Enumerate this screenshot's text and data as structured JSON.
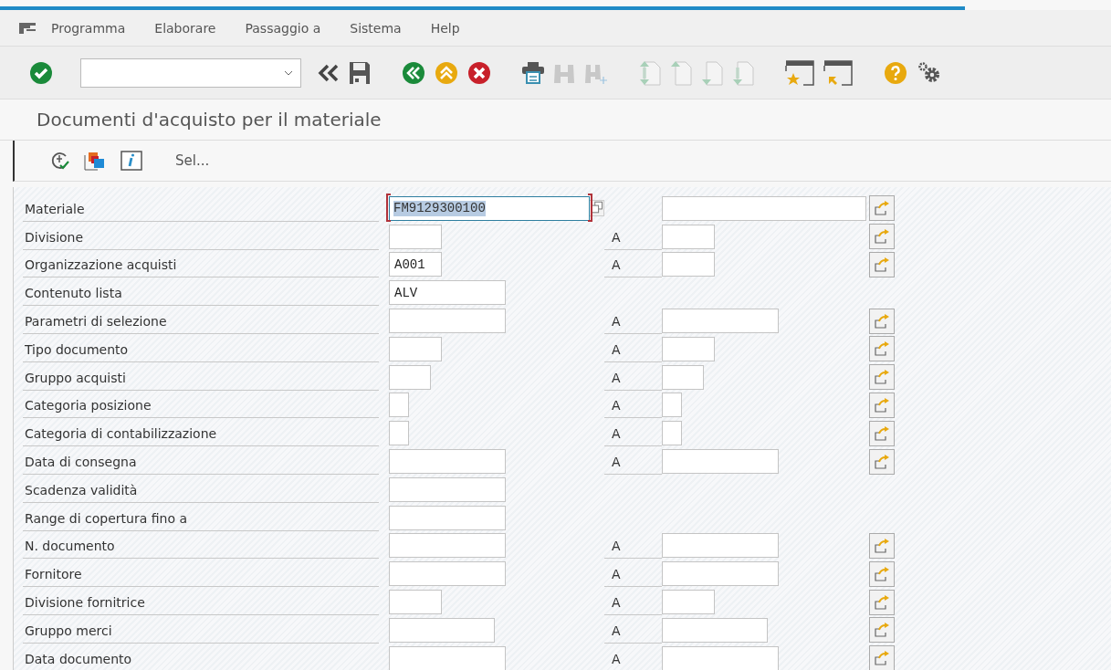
{
  "menu": [
    {
      "label": "Programma"
    },
    {
      "label": "Elaborare"
    },
    {
      "label": "Passaggio a"
    },
    {
      "label": "Sistema"
    },
    {
      "label": "Help"
    }
  ],
  "title": "Documenti d'acquisto per il materiale",
  "app_toolbar": {
    "selection_label": "Sel..."
  },
  "fields": [
    {
      "label": "Materiale",
      "value": "FM9129300100",
      "value_selected": true,
      "focused": true,
      "kind": "multi"
    },
    {
      "label": "Divisione",
      "kind": "range",
      "to_label": "A"
    },
    {
      "label": "Organizzazione acquisti",
      "value": "A001",
      "kind": "range",
      "to_label": "A"
    },
    {
      "label": "Contenuto lista",
      "value": "ALV",
      "kind": "single"
    },
    {
      "label": "Parametri di selezione",
      "kind": "range",
      "to_label": "A"
    },
    {
      "label": "Tipo documento",
      "kind": "range",
      "to_label": "A"
    },
    {
      "label": "Gruppo acquisti",
      "kind": "range",
      "to_label": "A"
    },
    {
      "label": "Categoria posizione",
      "kind": "range",
      "to_label": "A"
    },
    {
      "label": "Categoria di contabilizzazione",
      "kind": "range",
      "to_label": "A"
    },
    {
      "label": "Data di consegna",
      "kind": "range",
      "to_label": "A"
    },
    {
      "label": "Scadenza validità",
      "kind": "single"
    },
    {
      "label": "Range di copertura fino a",
      "kind": "single"
    },
    {
      "label": "N. documento",
      "kind": "range",
      "to_label": "A"
    },
    {
      "label": "Fornitore",
      "kind": "range",
      "to_label": "A"
    },
    {
      "label": "Divisione fornitrice",
      "kind": "range",
      "to_label": "A"
    },
    {
      "label": "Gruppo merci",
      "kind": "range",
      "to_label": "A"
    },
    {
      "label": "Data documento",
      "kind": "range",
      "to_label": "A"
    }
  ]
}
